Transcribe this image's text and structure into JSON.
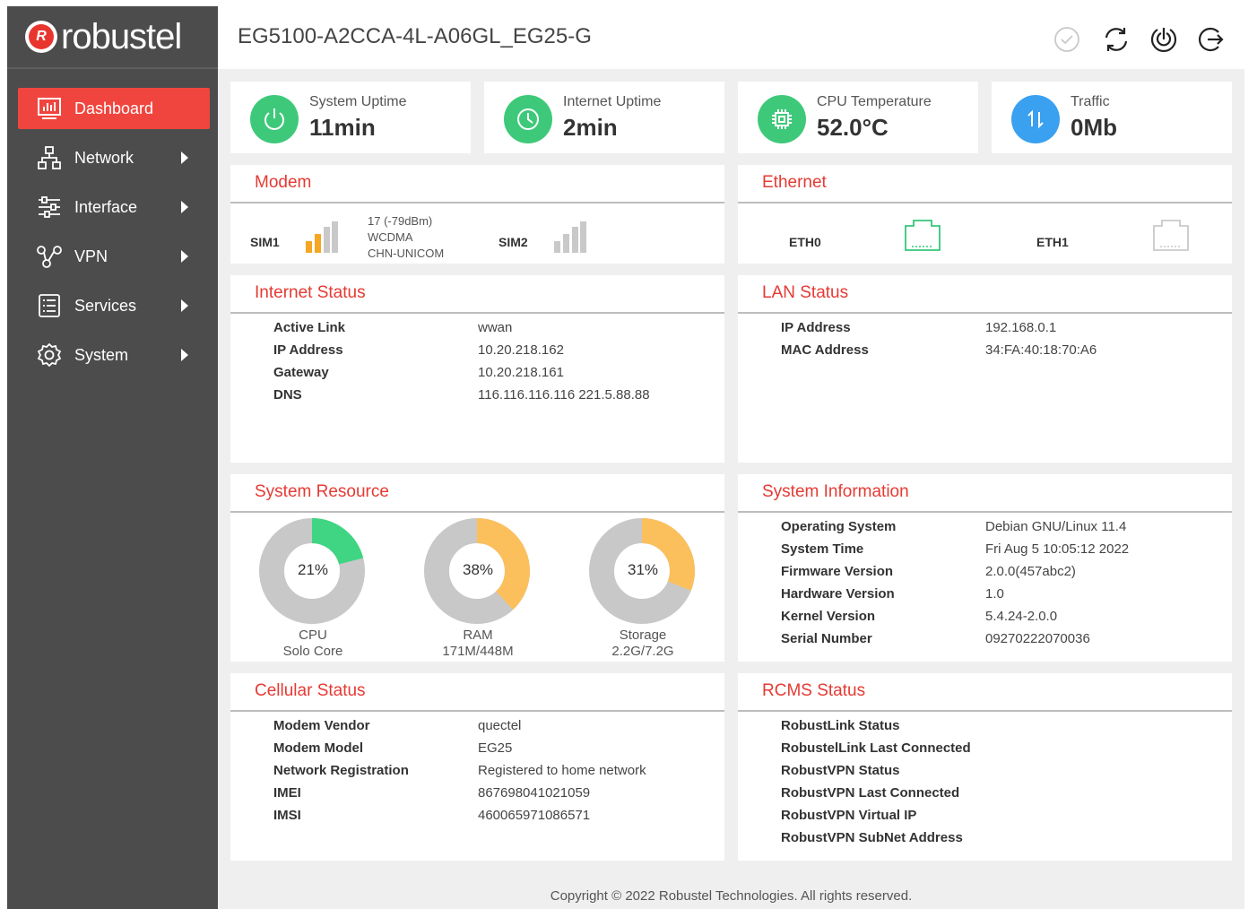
{
  "brand": {
    "name": "robustel",
    "logo_letter": "R"
  },
  "sidebar": {
    "items": [
      {
        "label": "Dashboard"
      },
      {
        "label": "Network"
      },
      {
        "label": "Interface"
      },
      {
        "label": "VPN"
      },
      {
        "label": "Services"
      },
      {
        "label": "System"
      }
    ]
  },
  "header": {
    "device_name": "EG5100-A2CCA-4L-A06GL_EG25-G",
    "icons": [
      "check-circle-icon",
      "sync-icon",
      "power-icon",
      "logout-icon"
    ]
  },
  "stats": [
    {
      "label": "System Uptime",
      "value": "11min",
      "color": "#3ec97a"
    },
    {
      "label": "Internet Uptime",
      "value": "2min",
      "color": "#3ec97a"
    },
    {
      "label": "CPU Temperature",
      "value": "52.0°C",
      "color": "#3ec97a"
    },
    {
      "label": "Traffic",
      "value": "0Mb",
      "color": "#3aa0f0"
    }
  ],
  "modem": {
    "title": "Modem",
    "sim1": {
      "label": "SIM1",
      "signal_line": "17 (-79dBm)",
      "network": "WCDMA",
      "operator": "CHN-UNICOM",
      "signal_bars_active": 2
    },
    "sim2": {
      "label": "SIM2",
      "signal_bars_active": 0
    }
  },
  "ethernet": {
    "title": "Ethernet",
    "ports": [
      {
        "label": "ETH0",
        "connected": true
      },
      {
        "label": "ETH1",
        "connected": false
      }
    ]
  },
  "internet_status": {
    "title": "Internet Status",
    "rows": [
      {
        "label": "Active Link",
        "value": "wwan"
      },
      {
        "label": "IP Address",
        "value": "10.20.218.162"
      },
      {
        "label": "Gateway",
        "value": "10.20.218.161"
      },
      {
        "label": "DNS",
        "value": "116.116.116.116 221.5.88.88"
      }
    ]
  },
  "lan_status": {
    "title": "LAN Status",
    "rows": [
      {
        "label": "IP Address",
        "value": "192.168.0.1"
      },
      {
        "label": "MAC Address",
        "value": "34:FA:40:18:70:A6"
      }
    ]
  },
  "system_resource": {
    "title": "System Resource",
    "items": [
      {
        "pct_text": "21%",
        "pct": 21,
        "name": "CPU",
        "detail": "Solo Core",
        "color": "#3fd583"
      },
      {
        "pct_text": "38%",
        "pct": 38,
        "name": "RAM",
        "detail": "171M/448M",
        "color": "#fbbf5c"
      },
      {
        "pct_text": "31%",
        "pct": 31,
        "name": "Storage",
        "detail": "2.2G/7.2G",
        "color": "#fbbf5c"
      }
    ]
  },
  "system_information": {
    "title": "System Information",
    "rows": [
      {
        "label": "Operating System",
        "value": "Debian GNU/Linux 11.4"
      },
      {
        "label": "System Time",
        "value": "Fri Aug 5 10:05:12 2022"
      },
      {
        "label": "Firmware Version",
        "value": "2.0.0(457abc2)"
      },
      {
        "label": "Hardware Version",
        "value": "1.0"
      },
      {
        "label": "Kernel Version",
        "value": "5.4.24-2.0.0"
      },
      {
        "label": "Serial Number",
        "value": "09270222070036"
      }
    ]
  },
  "cellular_status": {
    "title": "Cellular Status",
    "rows": [
      {
        "label": "Modem Vendor",
        "value": "quectel"
      },
      {
        "label": "Modem Model",
        "value": "EG25"
      },
      {
        "label": "Network Registration",
        "value": "Registered to home network"
      },
      {
        "label": "IMEI",
        "value": "867698041021059"
      },
      {
        "label": "IMSI",
        "value": "460065971086571"
      }
    ]
  },
  "rcms_status": {
    "title": "RCMS Status",
    "rows": [
      {
        "label": "RobustLink Status"
      },
      {
        "label": "RobustelLink Last Connected"
      },
      {
        "label": "RobustVPN Status"
      },
      {
        "label": "RobustVPN Last Connected"
      },
      {
        "label": "RobustVPN Virtual IP"
      },
      {
        "label": "RobustVPN SubNet Address"
      }
    ]
  },
  "footer": {
    "text": "Copyright © 2022 Robustel Technologies. All rights reserved."
  },
  "colors": {
    "accent": "#f0453e",
    "title_red": "#e53a33",
    "sidebar": "#4c4c4c",
    "gauge_track": "#c8c8c8"
  }
}
